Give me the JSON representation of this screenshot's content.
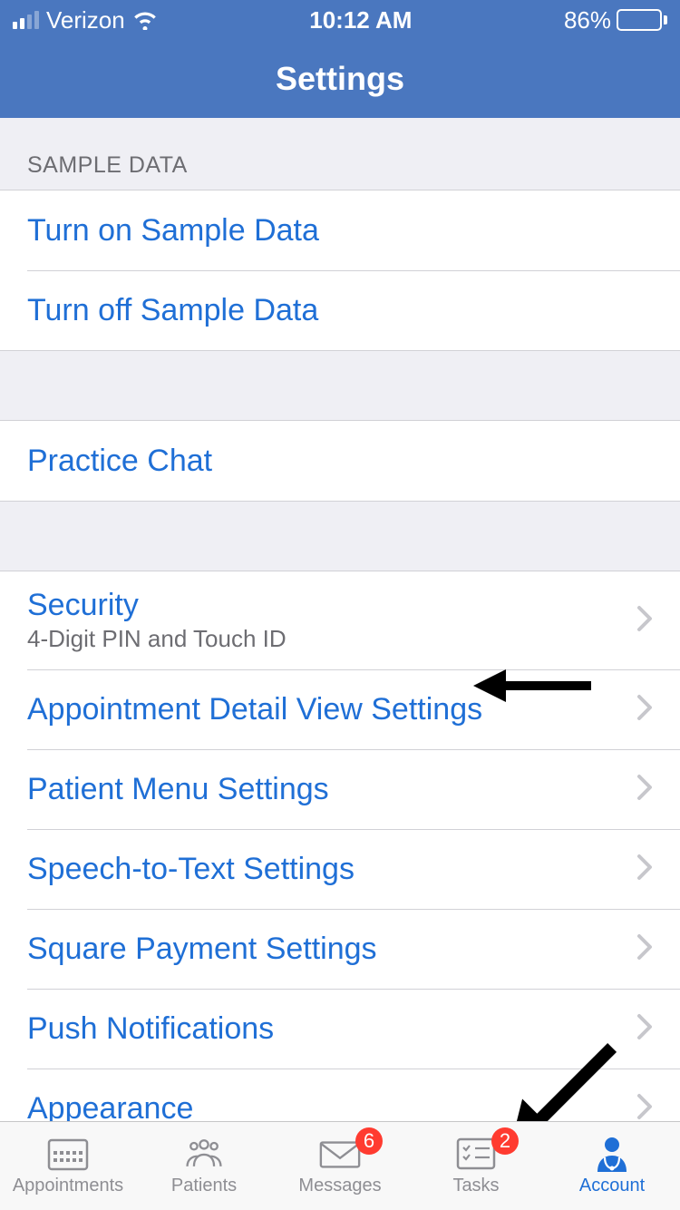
{
  "status": {
    "carrier": "Verizon",
    "time": "10:12 AM",
    "battery_pct": "86%",
    "battery_fill_pct": 86
  },
  "nav": {
    "title": "Settings"
  },
  "sections": {
    "sample_header": "SAMPLE DATA",
    "sample": {
      "turn_on": "Turn on Sample Data",
      "turn_off": "Turn off Sample Data"
    },
    "chat": {
      "practice_chat": "Practice Chat"
    },
    "main": {
      "security": {
        "label": "Security",
        "sub": "4-Digit PIN and Touch ID"
      },
      "appt_detail": "Appointment Detail View Settings",
      "patient_menu": "Patient Menu Settings",
      "speech": "Speech-to-Text Settings",
      "square": "Square Payment Settings",
      "push": "Push Notifications",
      "appearance": "Appearance"
    }
  },
  "tabs": {
    "appointments": "Appointments",
    "patients": "Patients",
    "messages": {
      "label": "Messages",
      "badge": "6"
    },
    "tasks": {
      "label": "Tasks",
      "badge": "2"
    },
    "account": "Account"
  }
}
